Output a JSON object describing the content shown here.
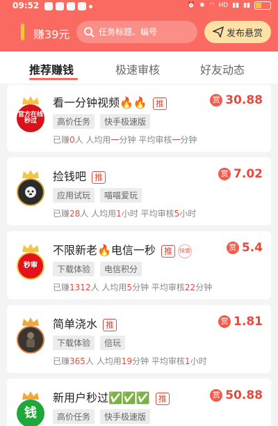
{
  "status_bar": {
    "time": "09:52"
  },
  "header": {
    "balance": "赚39元",
    "search_placeholder": "任务标题、编号",
    "post_button": "发布悬赏"
  },
  "tabs": [
    {
      "label": "推荐赚钱",
      "active": true
    },
    {
      "label": "极速审核",
      "active": false
    },
    {
      "label": "好友动态",
      "active": false
    }
  ],
  "tasks": [
    {
      "title": "看一分钟视频🔥🔥",
      "rec_label": "推",
      "avatar_text": "官方在线\n秒过",
      "tags": [
        "高价任务",
        "快手极速版"
      ],
      "reward_badge": "赏",
      "reward": "30.88",
      "stats": {
        "earned_prefix": "已赚",
        "earned": "0",
        "earned_unit": "人",
        "avg_use_prefix": "人均用",
        "avg_use": "一",
        "avg_use_unit": "分钟",
        "avg_review_prefix": "平均审核",
        "avg_review": "一",
        "avg_review_unit": "分钟"
      }
    },
    {
      "title": "捡钱吧",
      "rec_label": "推",
      "avatar_text": "",
      "tags": [
        "应用试玩",
        "喵喵爱玩"
      ],
      "reward_badge": "赏",
      "reward": "7.02",
      "stats": {
        "earned_prefix": "已赚",
        "earned": "28",
        "earned_unit": "人",
        "avg_use_prefix": "人均用",
        "avg_use": "1",
        "avg_use_unit": "小时",
        "avg_review_prefix": "平均审核",
        "avg_review": "5",
        "avg_review_unit": "小时"
      }
    },
    {
      "title": "不限新老🔥电信一秒",
      "rec_label": "推",
      "avatar_text": "秒审",
      "tags": [
        "下载体验",
        "电信积分"
      ],
      "reward_badge": "赏",
      "reward": "5.4",
      "extra_badge": "快审",
      "stats": {
        "earned_prefix": "已赚",
        "earned": "1312",
        "earned_unit": "人",
        "avg_use_prefix": "人均用",
        "avg_use": "5",
        "avg_use_unit": "分钟",
        "avg_review_prefix": "平均审核",
        "avg_review": "22",
        "avg_review_unit": "分钟"
      }
    },
    {
      "title": "简单浇水",
      "rec_label": "推",
      "avatar_text": "",
      "tags": [
        "下载体验",
        "倍玩"
      ],
      "reward_badge": "赏",
      "reward": "1.81",
      "stats": {
        "earned_prefix": "已赚",
        "earned": "365",
        "earned_unit": "人",
        "avg_use_prefix": "人均用",
        "avg_use": "19",
        "avg_use_unit": "分钟",
        "avg_review_prefix": "平均审核",
        "avg_review": "1",
        "avg_review_unit": "小时"
      }
    },
    {
      "title": "新用户秒过✅✅✅",
      "rec_label": "推",
      "avatar_text": "钱",
      "tags": [
        "高价任务",
        "快手极速版"
      ],
      "reward_badge": "赏",
      "reward": "50.88"
    }
  ],
  "colors": {
    "accent": "#fa6a60",
    "reward_red": "#e64a3c",
    "gold": "#f5c542"
  }
}
